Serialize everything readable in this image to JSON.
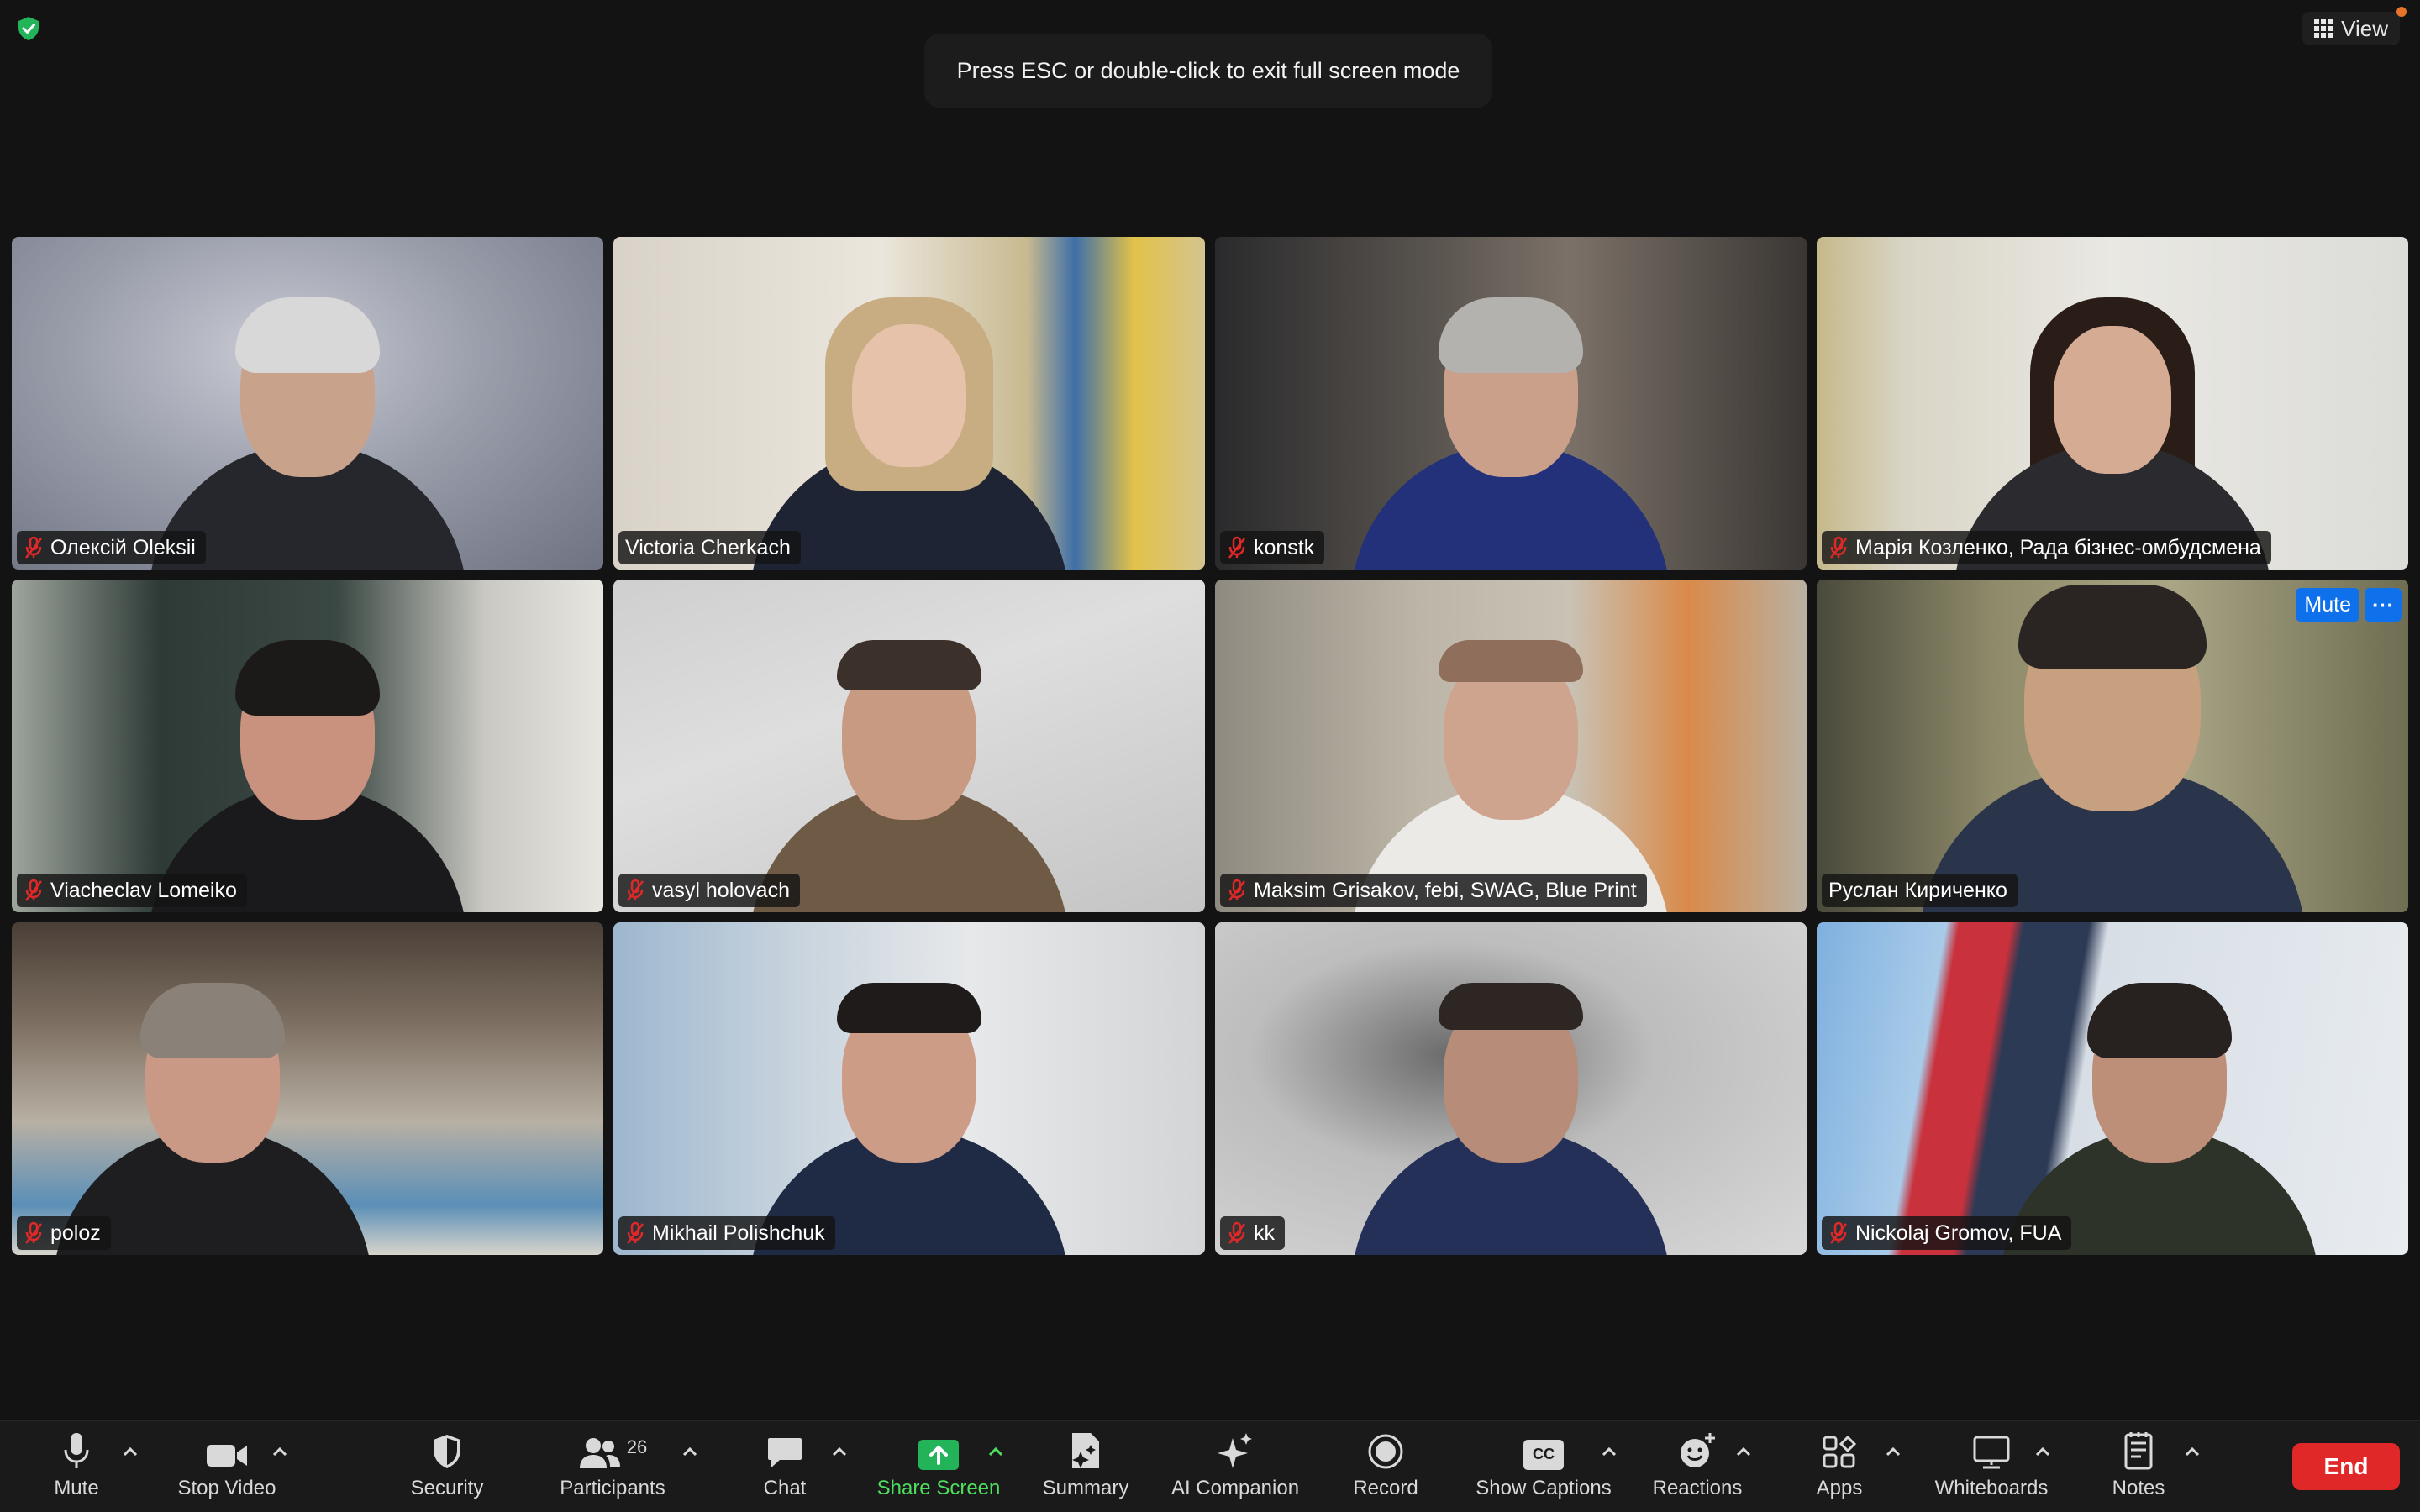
{
  "top": {
    "view_label": "View",
    "esc_banner": "Press ESC or double-click to exit full screen mode"
  },
  "participants": [
    {
      "name": "Олексій Oleksii",
      "muted": true
    },
    {
      "name": "Victoria Cherkach",
      "muted": false
    },
    {
      "name": "konstk",
      "muted": true
    },
    {
      "name": "Марія Козленко, Рада бізнес-омбудсмена",
      "muted": true
    },
    {
      "name": "Viacheclav Lomeiko",
      "muted": true
    },
    {
      "name": "vasyl holovach",
      "muted": true
    },
    {
      "name": "Maksim Grisakov, febi, SWAG, Blue Print",
      "muted": true
    },
    {
      "name": "Руслан Кириченко",
      "muted": false,
      "active_speaker": true
    },
    {
      "name": "poloz",
      "muted": true
    },
    {
      "name": "Mikhail Polishchuk",
      "muted": true
    },
    {
      "name": "kk",
      "muted": true
    },
    {
      "name": "Nickolaj Gromov, FUA",
      "muted": true
    }
  ],
  "tile_actions": {
    "mute_label": "Mute",
    "more_label": "···"
  },
  "toolbar": {
    "mute": "Mute",
    "stop_video": "Stop Video",
    "security": "Security",
    "participants": "Participants",
    "participants_count": "26",
    "chat": "Chat",
    "share_screen": "Share Screen",
    "summary": "Summary",
    "ai_companion": "AI Companion",
    "record": "Record",
    "show_captions": "Show Captions",
    "captions_badge": "CC",
    "reactions": "Reactions",
    "apps": "Apps",
    "whiteboards": "Whiteboards",
    "notes": "Notes",
    "end": "End"
  },
  "colors": {
    "accent_green": "#4ede5e",
    "end_red": "#e02828",
    "mute_blue": "#0e71eb",
    "muted_mic_red": "#e02828"
  }
}
